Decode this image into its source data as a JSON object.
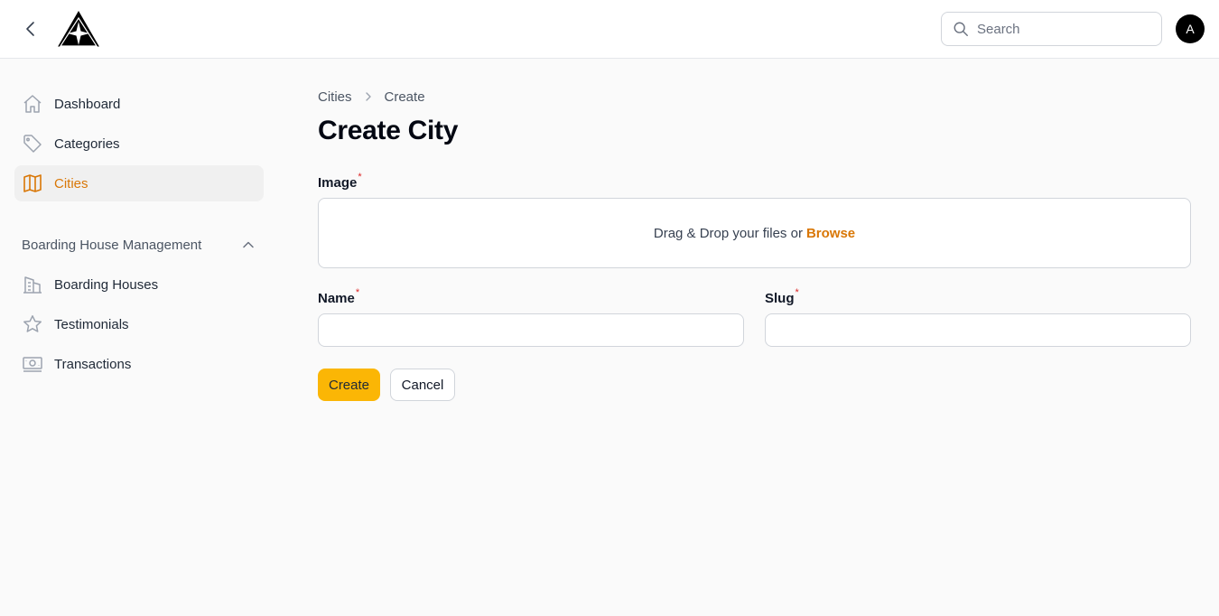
{
  "topbar": {
    "search_placeholder": "Search",
    "avatar_initial": "A"
  },
  "sidebar": {
    "items": [
      {
        "label": "Dashboard",
        "icon": "home-icon"
      },
      {
        "label": "Categories",
        "icon": "tag-icon"
      },
      {
        "label": "Cities",
        "icon": "map-icon",
        "active": true
      }
    ],
    "group": {
      "label": "Boarding House Management",
      "expanded": true,
      "items": [
        {
          "label": "Boarding Houses",
          "icon": "building-icon"
        },
        {
          "label": "Testimonials",
          "icon": "star-icon"
        },
        {
          "label": "Transactions",
          "icon": "banknotes-icon"
        }
      ]
    }
  },
  "main": {
    "breadcrumb": [
      "Cities",
      "Create"
    ],
    "title": "Create City",
    "form": {
      "image": {
        "label": "Image",
        "required_mark": "*",
        "dropzone_text": "Drag & Drop your files or",
        "browse_text": "Browse"
      },
      "name": {
        "label": "Name",
        "required_mark": "*",
        "value": ""
      },
      "slug": {
        "label": "Slug",
        "required_mark": "*",
        "value": ""
      }
    },
    "actions": {
      "create_label": "Create",
      "cancel_label": "Cancel"
    }
  },
  "colors": {
    "accent": "#d97706",
    "primary_button": "#fbb605",
    "required": "#dc2626"
  }
}
